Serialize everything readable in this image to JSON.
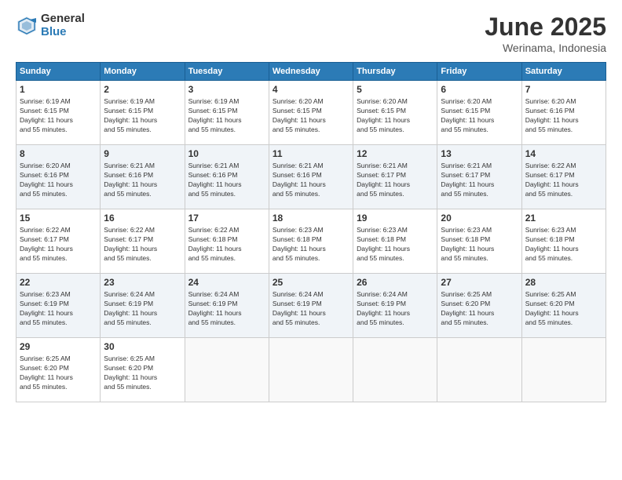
{
  "logo": {
    "general": "General",
    "blue": "Blue"
  },
  "title": {
    "month": "June 2025",
    "location": "Werinama, Indonesia"
  },
  "weekdays": [
    "Sunday",
    "Monday",
    "Tuesday",
    "Wednesday",
    "Thursday",
    "Friday",
    "Saturday"
  ],
  "weeks": [
    [
      {
        "day": "1",
        "info": "Sunrise: 6:19 AM\nSunset: 6:15 PM\nDaylight: 11 hours\nand 55 minutes."
      },
      {
        "day": "2",
        "info": "Sunrise: 6:19 AM\nSunset: 6:15 PM\nDaylight: 11 hours\nand 55 minutes."
      },
      {
        "day": "3",
        "info": "Sunrise: 6:19 AM\nSunset: 6:15 PM\nDaylight: 11 hours\nand 55 minutes."
      },
      {
        "day": "4",
        "info": "Sunrise: 6:20 AM\nSunset: 6:15 PM\nDaylight: 11 hours\nand 55 minutes."
      },
      {
        "day": "5",
        "info": "Sunrise: 6:20 AM\nSunset: 6:15 PM\nDaylight: 11 hours\nand 55 minutes."
      },
      {
        "day": "6",
        "info": "Sunrise: 6:20 AM\nSunset: 6:15 PM\nDaylight: 11 hours\nand 55 minutes."
      },
      {
        "day": "7",
        "info": "Sunrise: 6:20 AM\nSunset: 6:16 PM\nDaylight: 11 hours\nand 55 minutes."
      }
    ],
    [
      {
        "day": "8",
        "info": "Sunrise: 6:20 AM\nSunset: 6:16 PM\nDaylight: 11 hours\nand 55 minutes."
      },
      {
        "day": "9",
        "info": "Sunrise: 6:21 AM\nSunset: 6:16 PM\nDaylight: 11 hours\nand 55 minutes."
      },
      {
        "day": "10",
        "info": "Sunrise: 6:21 AM\nSunset: 6:16 PM\nDaylight: 11 hours\nand 55 minutes."
      },
      {
        "day": "11",
        "info": "Sunrise: 6:21 AM\nSunset: 6:16 PM\nDaylight: 11 hours\nand 55 minutes."
      },
      {
        "day": "12",
        "info": "Sunrise: 6:21 AM\nSunset: 6:17 PM\nDaylight: 11 hours\nand 55 minutes."
      },
      {
        "day": "13",
        "info": "Sunrise: 6:21 AM\nSunset: 6:17 PM\nDaylight: 11 hours\nand 55 minutes."
      },
      {
        "day": "14",
        "info": "Sunrise: 6:22 AM\nSunset: 6:17 PM\nDaylight: 11 hours\nand 55 minutes."
      }
    ],
    [
      {
        "day": "15",
        "info": "Sunrise: 6:22 AM\nSunset: 6:17 PM\nDaylight: 11 hours\nand 55 minutes."
      },
      {
        "day": "16",
        "info": "Sunrise: 6:22 AM\nSunset: 6:17 PM\nDaylight: 11 hours\nand 55 minutes."
      },
      {
        "day": "17",
        "info": "Sunrise: 6:22 AM\nSunset: 6:18 PM\nDaylight: 11 hours\nand 55 minutes."
      },
      {
        "day": "18",
        "info": "Sunrise: 6:23 AM\nSunset: 6:18 PM\nDaylight: 11 hours\nand 55 minutes."
      },
      {
        "day": "19",
        "info": "Sunrise: 6:23 AM\nSunset: 6:18 PM\nDaylight: 11 hours\nand 55 minutes."
      },
      {
        "day": "20",
        "info": "Sunrise: 6:23 AM\nSunset: 6:18 PM\nDaylight: 11 hours\nand 55 minutes."
      },
      {
        "day": "21",
        "info": "Sunrise: 6:23 AM\nSunset: 6:18 PM\nDaylight: 11 hours\nand 55 minutes."
      }
    ],
    [
      {
        "day": "22",
        "info": "Sunrise: 6:23 AM\nSunset: 6:19 PM\nDaylight: 11 hours\nand 55 minutes."
      },
      {
        "day": "23",
        "info": "Sunrise: 6:24 AM\nSunset: 6:19 PM\nDaylight: 11 hours\nand 55 minutes."
      },
      {
        "day": "24",
        "info": "Sunrise: 6:24 AM\nSunset: 6:19 PM\nDaylight: 11 hours\nand 55 minutes."
      },
      {
        "day": "25",
        "info": "Sunrise: 6:24 AM\nSunset: 6:19 PM\nDaylight: 11 hours\nand 55 minutes."
      },
      {
        "day": "26",
        "info": "Sunrise: 6:24 AM\nSunset: 6:19 PM\nDaylight: 11 hours\nand 55 minutes."
      },
      {
        "day": "27",
        "info": "Sunrise: 6:25 AM\nSunset: 6:20 PM\nDaylight: 11 hours\nand 55 minutes."
      },
      {
        "day": "28",
        "info": "Sunrise: 6:25 AM\nSunset: 6:20 PM\nDaylight: 11 hours\nand 55 minutes."
      }
    ],
    [
      {
        "day": "29",
        "info": "Sunrise: 6:25 AM\nSunset: 6:20 PM\nDaylight: 11 hours\nand 55 minutes."
      },
      {
        "day": "30",
        "info": "Sunrise: 6:25 AM\nSunset: 6:20 PM\nDaylight: 11 hours\nand 55 minutes."
      },
      {
        "day": "",
        "info": ""
      },
      {
        "day": "",
        "info": ""
      },
      {
        "day": "",
        "info": ""
      },
      {
        "day": "",
        "info": ""
      },
      {
        "day": "",
        "info": ""
      }
    ]
  ]
}
